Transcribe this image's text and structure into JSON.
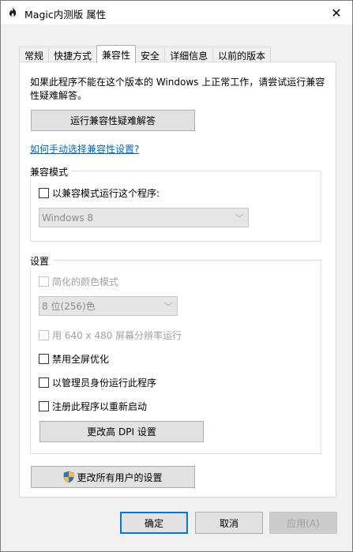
{
  "window": {
    "title": "Magic内测版 属性",
    "close_symbol": "✕"
  },
  "tabs": [
    {
      "label": "常规"
    },
    {
      "label": "快捷方式"
    },
    {
      "label": "兼容性"
    },
    {
      "label": "安全"
    },
    {
      "label": "详细信息"
    },
    {
      "label": "以前的版本"
    }
  ],
  "intro": "如果此程序不能在这个版本的 Windows 上正常工作，请尝试运行兼容性疑难解答。",
  "troubleshoot_button": "运行兼容性疑难解答",
  "manual_link": "如何手动选择兼容性设置?",
  "compat_mode": {
    "group_label": "兼容模式",
    "checkbox_label": "以兼容模式运行这个程序:",
    "os_select": "Windows 8"
  },
  "settings": {
    "group_label": "设置",
    "reduced_color": "简化的颜色模式",
    "color_select": "8 位(256)色",
    "resolution_640": "用 640 x 480 屏幕分辨率运行",
    "disable_fullscreen": "禁用全屏优化",
    "run_as_admin": "以管理员身份运行此程序",
    "register_restart": "注册此程序以重新启动",
    "dpi_button": "更改高 DPI 设置"
  },
  "all_users_button": "更改所有用户的设置",
  "footer": {
    "ok": "确定",
    "cancel": "取消",
    "apply": "应用(A)"
  },
  "icons": {
    "app": "flame-app-icon",
    "shield": "uac-shield-icon"
  },
  "colors": {
    "link": "#0066cc",
    "default_button_border": "#0078d7"
  }
}
